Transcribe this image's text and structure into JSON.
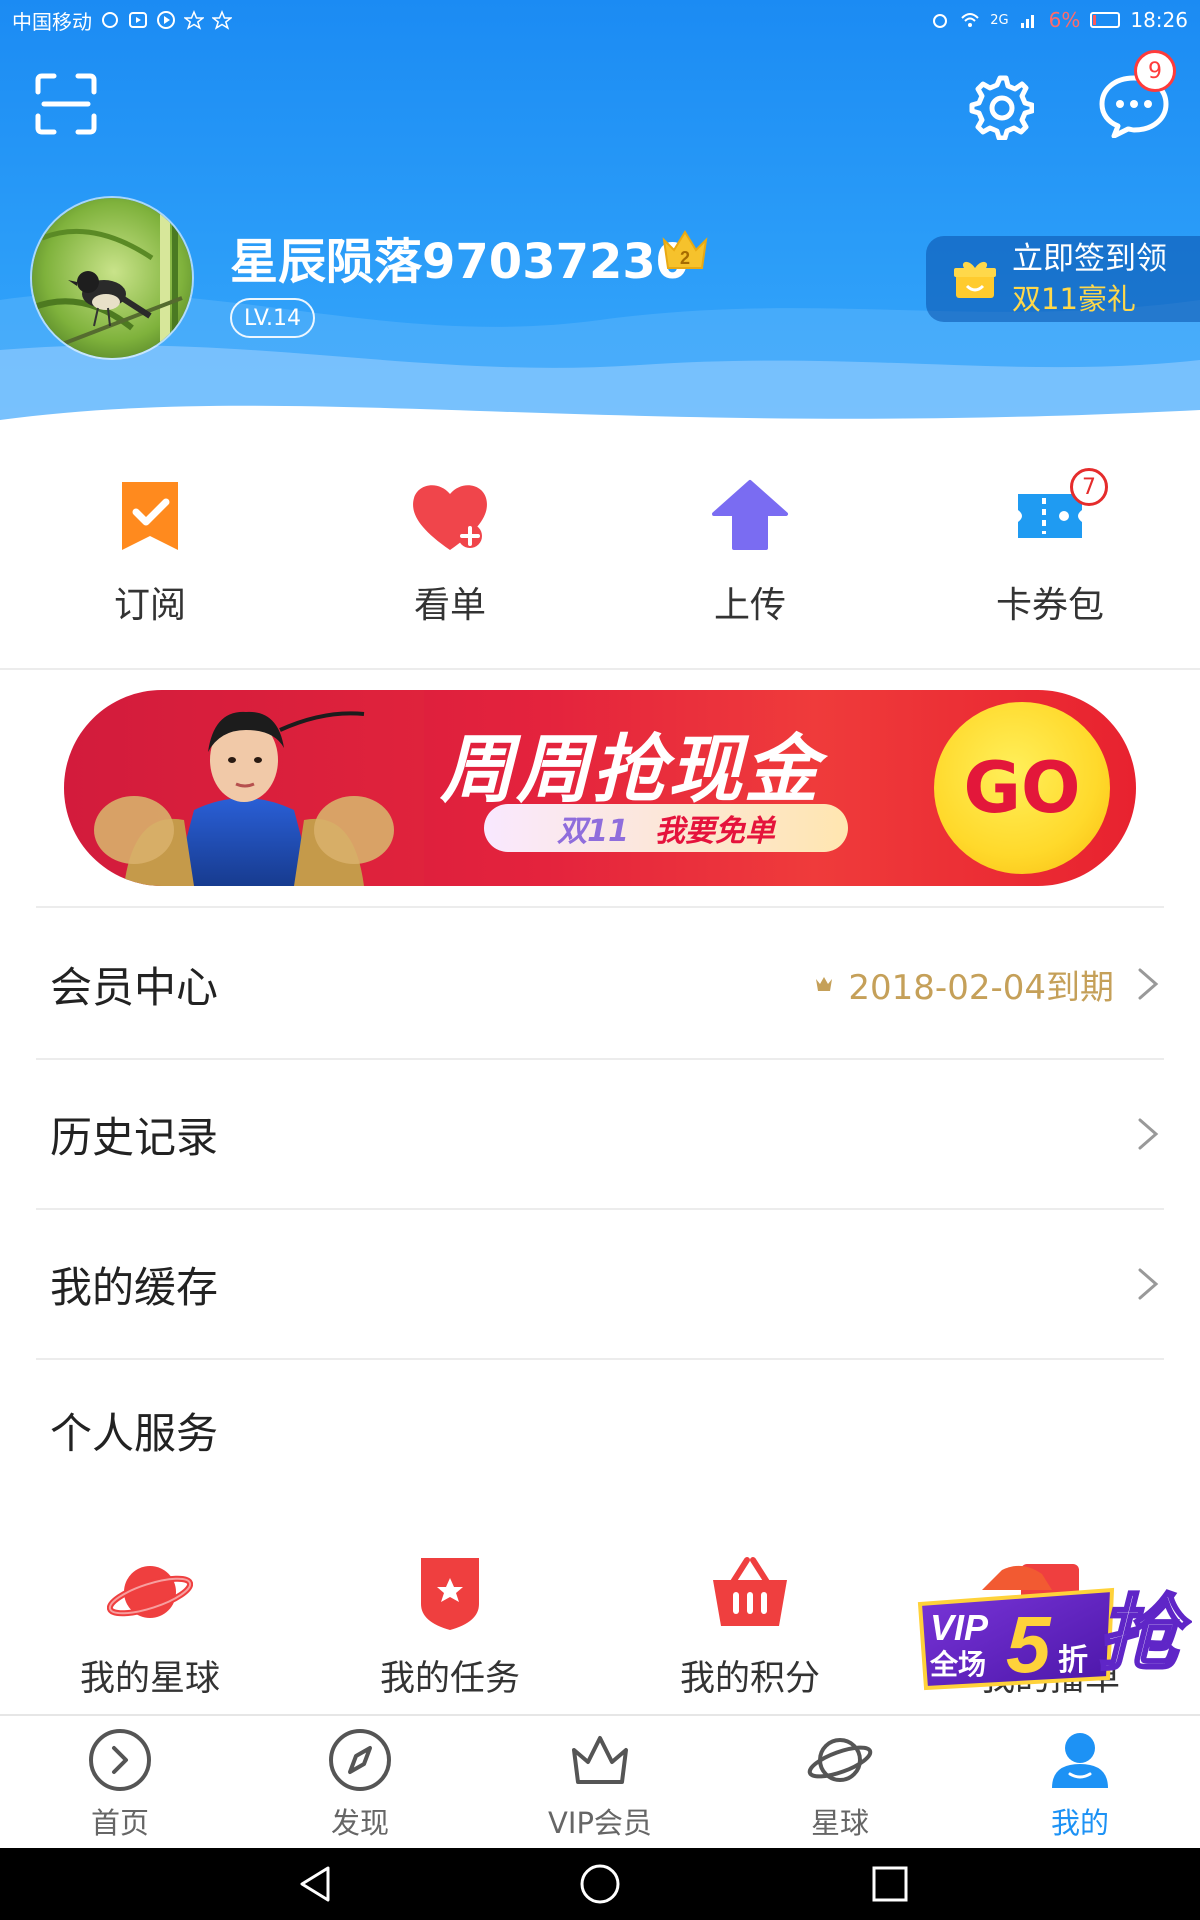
{
  "status_bar": {
    "carrier": "中国移动",
    "network": "2G",
    "battery_percent": "6%",
    "time": "18:26"
  },
  "header": {
    "message_badge": "9",
    "username": "星辰陨落97037230",
    "vip_crown_number": "2",
    "level": "LV.14",
    "signin_line1": "立即签到领",
    "signin_line2": "双11豪礼"
  },
  "quick_actions": [
    {
      "label": "订阅",
      "icon": "bookmark-check-icon"
    },
    {
      "label": "看单",
      "icon": "heart-plus-icon"
    },
    {
      "label": "上传",
      "icon": "upload-arrow-icon"
    },
    {
      "label": "卡券包",
      "icon": "ticket-icon",
      "badge": "7"
    }
  ],
  "banner": {
    "title": "周周抢现金",
    "tag": "双11",
    "subtitle": "我要免单",
    "go": "GO"
  },
  "list": {
    "vip_center": {
      "label": "会员中心",
      "value": "2018-02-04到期"
    },
    "history": {
      "label": "历史记录"
    },
    "cache": {
      "label": "我的缓存"
    }
  },
  "section": {
    "title": "个人服务"
  },
  "services": [
    {
      "label": "我的星球",
      "icon": "planet-icon"
    },
    {
      "label": "我的任务",
      "icon": "task-shield-icon"
    },
    {
      "label": "我的积分",
      "icon": "basket-icon"
    },
    {
      "label": "我的播单",
      "icon": "playlist-icon"
    }
  ],
  "vip_promo": {
    "line1": "VIP",
    "line2": "全场",
    "big": "5",
    "suffix": "折",
    "grab": "抢"
  },
  "tabs": [
    {
      "label": "首页",
      "icon": "play-circle-icon"
    },
    {
      "label": "发现",
      "icon": "compass-icon"
    },
    {
      "label": "VIP会员",
      "icon": "crown-icon"
    },
    {
      "label": "星球",
      "icon": "planet-icon"
    },
    {
      "label": "我的",
      "icon": "user-icon",
      "active": true
    }
  ],
  "colors": {
    "header_blue": "#1b8bf3",
    "tab_active": "#1d92f5",
    "vip_gold": "#c5a059",
    "badge_red": "#e52c2c"
  }
}
